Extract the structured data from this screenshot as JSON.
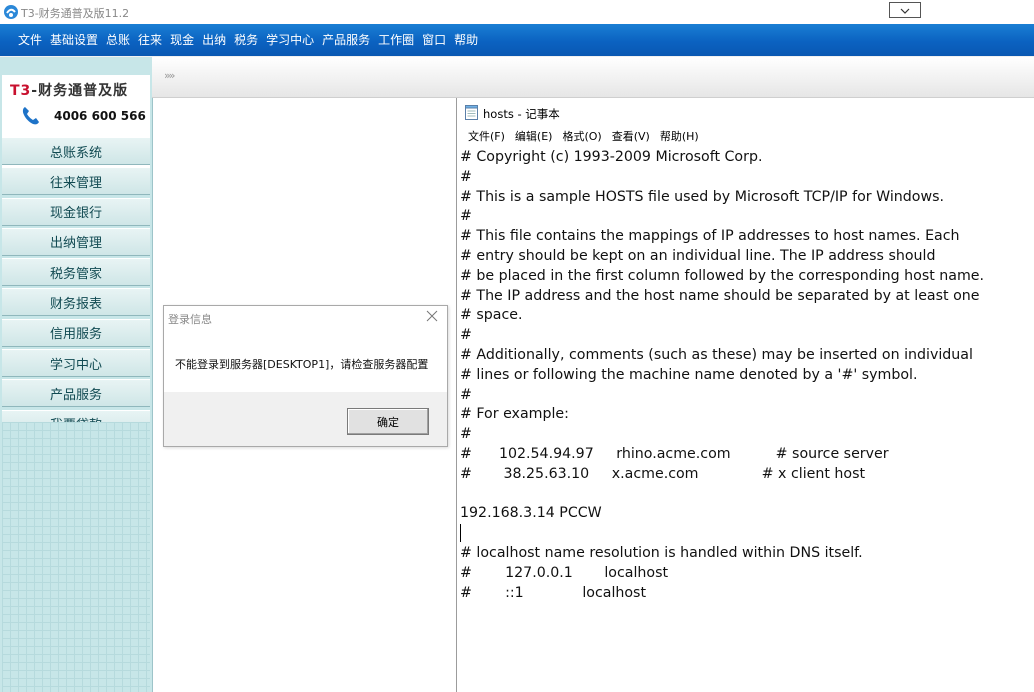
{
  "app": {
    "title": "T3-财务通普及版11.2",
    "brand_prefix": "T3",
    "brand_rest": "-财务通普及版",
    "phone": "4006 600 566"
  },
  "menu": [
    "文件",
    "基础设置",
    "总账",
    "往来",
    "现金",
    "出纳",
    "税务",
    "学习中心",
    "产品服务",
    "工作圈",
    "窗口",
    "帮助"
  ],
  "navstrip": {
    "expand_label": "»»"
  },
  "sidebar": {
    "items": [
      "总账系统",
      "往来管理",
      "现金银行",
      "出纳管理",
      "税务管家",
      "财务报表",
      "信用服务",
      "学习中心",
      "产品服务",
      "我要贷款"
    ]
  },
  "notepad": {
    "title": "hosts - 记事本",
    "menu": [
      "文件(F)",
      "编辑(E)",
      "格式(O)",
      "查看(V)",
      "帮助(H)"
    ],
    "lines": [
      "# Copyright (c) 1993-2009 Microsoft Corp.",
      "#",
      "# This is a sample HOSTS file used by Microsoft TCP/IP for Windows.",
      "#",
      "# This file contains the mappings of IP addresses to host names. Each",
      "# entry should be kept on an individual line. The IP address should",
      "# be placed in the first column followed by the corresponding host name.",
      "# The IP address and the host name should be separated by at least one",
      "# space.",
      "#",
      "# Additionally, comments (such as these) may be inserted on individual",
      "# lines or following the machine name denoted by a '#' symbol.",
      "#",
      "# For example:",
      "#",
      "#      102.54.94.97     rhino.acme.com          # source server",
      "#       38.25.63.10     x.acme.com              # x client host",
      "",
      "192.168.3.14 PCCW",
      "",
      "# localhost name resolution is handled within DNS itself.",
      "#\t127.0.0.1       localhost",
      "#\t::1             localhost"
    ]
  },
  "dialog": {
    "title": "登录信息",
    "message": "不能登录到服务器[DESKTOP1]，请检查服务器配置",
    "ok_label": "确定"
  },
  "colors": {
    "menubar": "#0b62c1",
    "sidebar_bg": "#c7e6e8",
    "brand_red": "#c8102e"
  },
  "icons": {
    "app": "t3-app-icon",
    "phone": "phone-icon",
    "notepad": "notepad-icon",
    "close": "close-icon",
    "minimize": "chevron-down-icon"
  }
}
